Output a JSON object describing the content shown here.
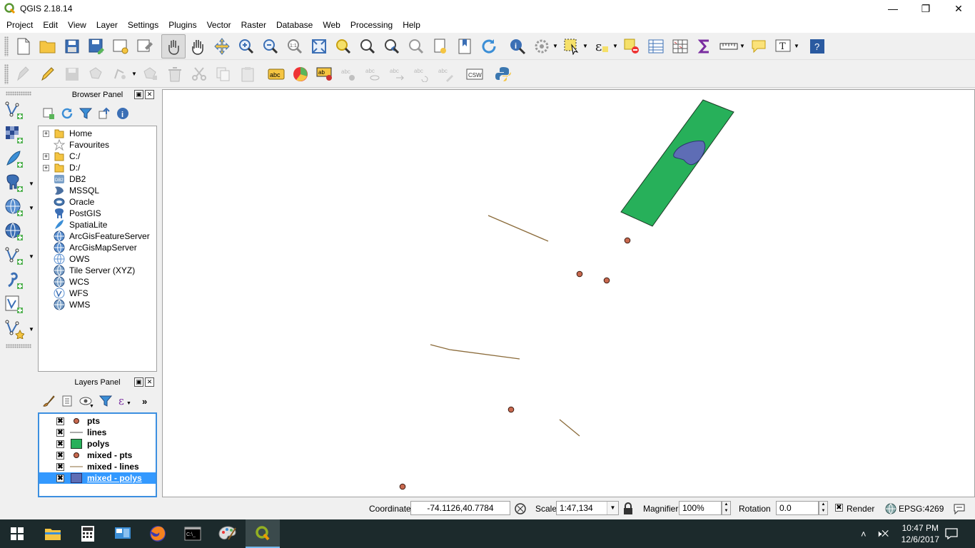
{
  "window": {
    "title": "QGIS 2.18.14",
    "minimize": "—",
    "restore": "❐",
    "close": "✕"
  },
  "menu": [
    "Project",
    "Edit",
    "View",
    "Layer",
    "Settings",
    "Plugins",
    "Vector",
    "Raster",
    "Database",
    "Web",
    "Processing",
    "Help"
  ],
  "browser_panel": {
    "title": "Browser Panel",
    "items": [
      {
        "label": "Home",
        "icon": "folder-icon",
        "expandable": true
      },
      {
        "label": "Favourites",
        "icon": "star-icon",
        "expandable": false
      },
      {
        "label": "C:/",
        "icon": "folder-icon",
        "expandable": true
      },
      {
        "label": "D:/",
        "icon": "folder-icon",
        "expandable": true
      },
      {
        "label": "DB2",
        "icon": "db2-icon",
        "expandable": false
      },
      {
        "label": "MSSQL",
        "icon": "mssql-icon",
        "expandable": false
      },
      {
        "label": "Oracle",
        "icon": "oracle-icon",
        "expandable": false
      },
      {
        "label": "PostGIS",
        "icon": "postgis-icon",
        "expandable": false
      },
      {
        "label": "SpatiaLite",
        "icon": "spatialite-icon",
        "expandable": false
      },
      {
        "label": "ArcGisFeatureServer",
        "icon": "arcgis-icon",
        "expandable": false
      },
      {
        "label": "ArcGisMapServer",
        "icon": "arcgis-icon",
        "expandable": false
      },
      {
        "label": "OWS",
        "icon": "ows-icon",
        "expandable": false
      },
      {
        "label": "Tile Server (XYZ)",
        "icon": "globe-icon",
        "expandable": false
      },
      {
        "label": "WCS",
        "icon": "globe-icon",
        "expandable": false
      },
      {
        "label": "WFS",
        "icon": "wfs-icon",
        "expandable": false
      },
      {
        "label": "WMS",
        "icon": "globe-icon",
        "expandable": false
      }
    ]
  },
  "layers_panel": {
    "title": "Layers Panel",
    "layers": [
      {
        "name": "pts",
        "symbol": "point",
        "checked": true,
        "selected": false
      },
      {
        "name": "lines",
        "symbol": "line",
        "checked": true,
        "selected": false
      },
      {
        "name": "polys",
        "symbol": "polygon-green",
        "checked": true,
        "selected": false
      },
      {
        "name": "mixed - pts",
        "symbol": "point",
        "checked": true,
        "selected": false
      },
      {
        "name": "mixed - lines",
        "symbol": "line-thin",
        "checked": true,
        "selected": false
      },
      {
        "name": "mixed - polys",
        "symbol": "polygon-blue",
        "checked": true,
        "selected": true
      }
    ]
  },
  "colors": {
    "point_fill": "#c8694f",
    "line": "#8b6b3a",
    "polygon_green": "#27b05a",
    "polygon_blue": "#5e6db5",
    "selection": "#3399ff"
  },
  "statusbar": {
    "coordinate_label": "Coordinate",
    "coordinate_value": "-74.1126,40.7784",
    "scale_label": "Scale",
    "scale_value": "1:47,134",
    "magnifier_label": "Magnifier",
    "magnifier_value": "100%",
    "rotation_label": "Rotation",
    "rotation_value": "0.0",
    "render_label": "Render",
    "crs": "EPSG:4269"
  },
  "taskbar": {
    "time": "10:47 PM",
    "date": "12/6/2017"
  }
}
